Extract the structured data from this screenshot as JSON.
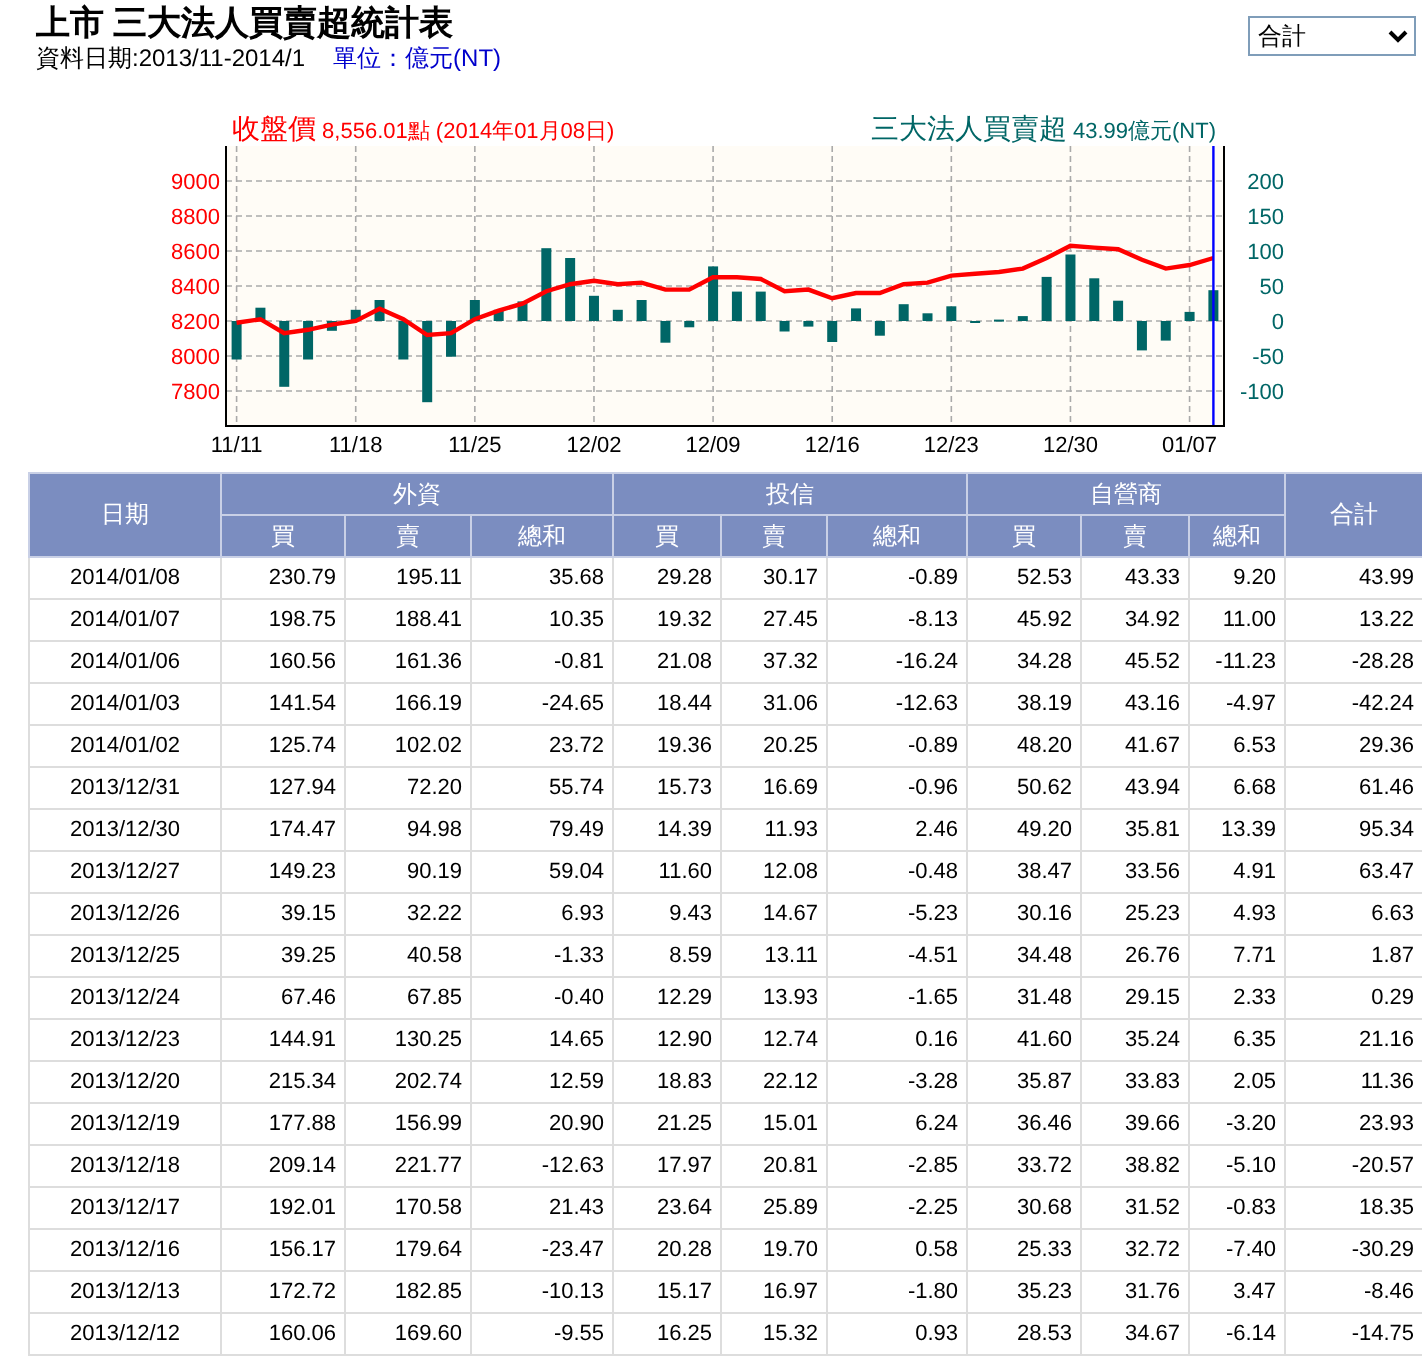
{
  "header": {
    "title": "上市 三大法人買賣超統計表",
    "date_range": "資料日期:2013/11-2014/1",
    "unit": "單位：億元(NT)"
  },
  "dropdown": {
    "value": "合計"
  },
  "chart": {
    "readings": [
      "8,556.01點 (2014年01月08日)",
      "43.99億元(NT)"
    ],
    "chart_data": {
      "type": "bar",
      "grid": true,
      "categories": [
        "11/11",
        null,
        null,
        null,
        null,
        "11/18",
        null,
        null,
        null,
        null,
        "11/25",
        null,
        null,
        null,
        null,
        "12/02",
        null,
        null,
        null,
        null,
        "12/09",
        null,
        null,
        null,
        null,
        "12/16",
        null,
        null,
        null,
        null,
        "12/23",
        null,
        null,
        null,
        null,
        "12/30",
        null,
        null,
        null,
        null,
        "01/07",
        null
      ],
      "series": [
        {
          "name": "三大法人買賣超",
          "axis": "y2",
          "color": "#006666",
          "values": [
            -55,
            19,
            -94,
            -55,
            -14,
            16,
            30,
            -55,
            -116,
            -51,
            30,
            16,
            28,
            104,
            90,
            36,
            16,
            30,
            -31,
            -9,
            78,
            42,
            42,
            -15,
            -8,
            -30,
            18,
            -21,
            24,
            11,
            21,
            0,
            2,
            7,
            63,
            95,
            61,
            29,
            -42,
            -28,
            13,
            44
          ]
        },
        {
          "name": "收盤價",
          "type": "line",
          "color": "#ff0000",
          "values": [
            8190,
            8210,
            8130,
            8150,
            8180,
            8200,
            8270,
            8210,
            8120,
            8130,
            8210,
            8260,
            8300,
            8370,
            8410,
            8430,
            8410,
            8420,
            8380,
            8380,
            8450,
            8450,
            8440,
            8370,
            8380,
            8330,
            8360,
            8360,
            8410,
            8420,
            8460,
            8470,
            8480,
            8500,
            8560,
            8630,
            8620,
            8610,
            8550,
            8500,
            8520,
            8560
          ]
        }
      ],
      "ylim": [
        7600,
        9200
      ],
      "yticks": [
        7800,
        8000,
        8200,
        8400,
        8600,
        8800,
        9000
      ],
      "y2lim": [
        -150,
        250
      ],
      "y2ticks": [
        -100,
        -50,
        0,
        50,
        100,
        150,
        200
      ]
    }
  },
  "table": {
    "header_rows": [
      [
        {
          "label": "日期",
          "rowspan": 2
        },
        {
          "label": "外資",
          "colspan": 3
        },
        {
          "label": "投信",
          "colspan": 3
        },
        {
          "label": "自營商",
          "colspan": 3
        },
        {
          "label": "合計",
          "rowspan": 2
        }
      ],
      [
        {
          "label": "買"
        },
        {
          "label": "賣"
        },
        {
          "label": "總和"
        },
        {
          "label": "買"
        },
        {
          "label": "賣"
        },
        {
          "label": "總和"
        },
        {
          "label": "買"
        },
        {
          "label": "賣"
        },
        {
          "label": "總和"
        }
      ]
    ],
    "rows": [
      [
        "2014/01/08",
        "230.79",
        "195.11",
        "35.68",
        "29.28",
        "30.17",
        "-0.89",
        "52.53",
        "43.33",
        "9.20",
        "43.99"
      ],
      [
        "2014/01/07",
        "198.75",
        "188.41",
        "10.35",
        "19.32",
        "27.45",
        "-8.13",
        "45.92",
        "34.92",
        "11.00",
        "13.22"
      ],
      [
        "2014/01/06",
        "160.56",
        "161.36",
        "-0.81",
        "21.08",
        "37.32",
        "-16.24",
        "34.28",
        "45.52",
        "-11.23",
        "-28.28"
      ],
      [
        "2014/01/03",
        "141.54",
        "166.19",
        "-24.65",
        "18.44",
        "31.06",
        "-12.63",
        "38.19",
        "43.16",
        "-4.97",
        "-42.24"
      ],
      [
        "2014/01/02",
        "125.74",
        "102.02",
        "23.72",
        "19.36",
        "20.25",
        "-0.89",
        "48.20",
        "41.67",
        "6.53",
        "29.36"
      ],
      [
        "2013/12/31",
        "127.94",
        "72.20",
        "55.74",
        "15.73",
        "16.69",
        "-0.96",
        "50.62",
        "43.94",
        "6.68",
        "61.46"
      ],
      [
        "2013/12/30",
        "174.47",
        "94.98",
        "79.49",
        "14.39",
        "11.93",
        "2.46",
        "49.20",
        "35.81",
        "13.39",
        "95.34"
      ],
      [
        "2013/12/27",
        "149.23",
        "90.19",
        "59.04",
        "11.60",
        "12.08",
        "-0.48",
        "38.47",
        "33.56",
        "4.91",
        "63.47"
      ],
      [
        "2013/12/26",
        "39.15",
        "32.22",
        "6.93",
        "9.43",
        "14.67",
        "-5.23",
        "30.16",
        "25.23",
        "4.93",
        "6.63"
      ],
      [
        "2013/12/25",
        "39.25",
        "40.58",
        "-1.33",
        "8.59",
        "13.11",
        "-4.51",
        "34.48",
        "26.76",
        "7.71",
        "1.87"
      ],
      [
        "2013/12/24",
        "67.46",
        "67.85",
        "-0.40",
        "12.29",
        "13.93",
        "-1.65",
        "31.48",
        "29.15",
        "2.33",
        "0.29"
      ],
      [
        "2013/12/23",
        "144.91",
        "130.25",
        "14.65",
        "12.90",
        "12.74",
        "0.16",
        "41.60",
        "35.24",
        "6.35",
        "21.16"
      ],
      [
        "2013/12/20",
        "215.34",
        "202.74",
        "12.59",
        "18.83",
        "22.12",
        "-3.28",
        "35.87",
        "33.83",
        "2.05",
        "11.36"
      ],
      [
        "2013/12/19",
        "177.88",
        "156.99",
        "20.90",
        "21.25",
        "15.01",
        "6.24",
        "36.46",
        "39.66",
        "-3.20",
        "23.93"
      ],
      [
        "2013/12/18",
        "209.14",
        "221.77",
        "-12.63",
        "17.97",
        "20.81",
        "-2.85",
        "33.72",
        "38.82",
        "-5.10",
        "-20.57"
      ],
      [
        "2013/12/17",
        "192.01",
        "170.58",
        "21.43",
        "23.64",
        "25.89",
        "-2.25",
        "30.68",
        "31.52",
        "-0.83",
        "18.35"
      ],
      [
        "2013/12/16",
        "156.17",
        "179.64",
        "-23.47",
        "20.28",
        "19.70",
        "0.58",
        "25.33",
        "32.72",
        "-7.40",
        "-30.29"
      ],
      [
        "2013/12/13",
        "172.72",
        "182.85",
        "-10.13",
        "15.17",
        "16.97",
        "-1.80",
        "35.23",
        "31.76",
        "3.47",
        "-8.46"
      ],
      [
        "2013/12/12",
        "160.06",
        "169.60",
        "-9.55",
        "16.25",
        "15.32",
        "0.93",
        "28.53",
        "34.67",
        "-6.14",
        "-14.75"
      ]
    ]
  }
}
